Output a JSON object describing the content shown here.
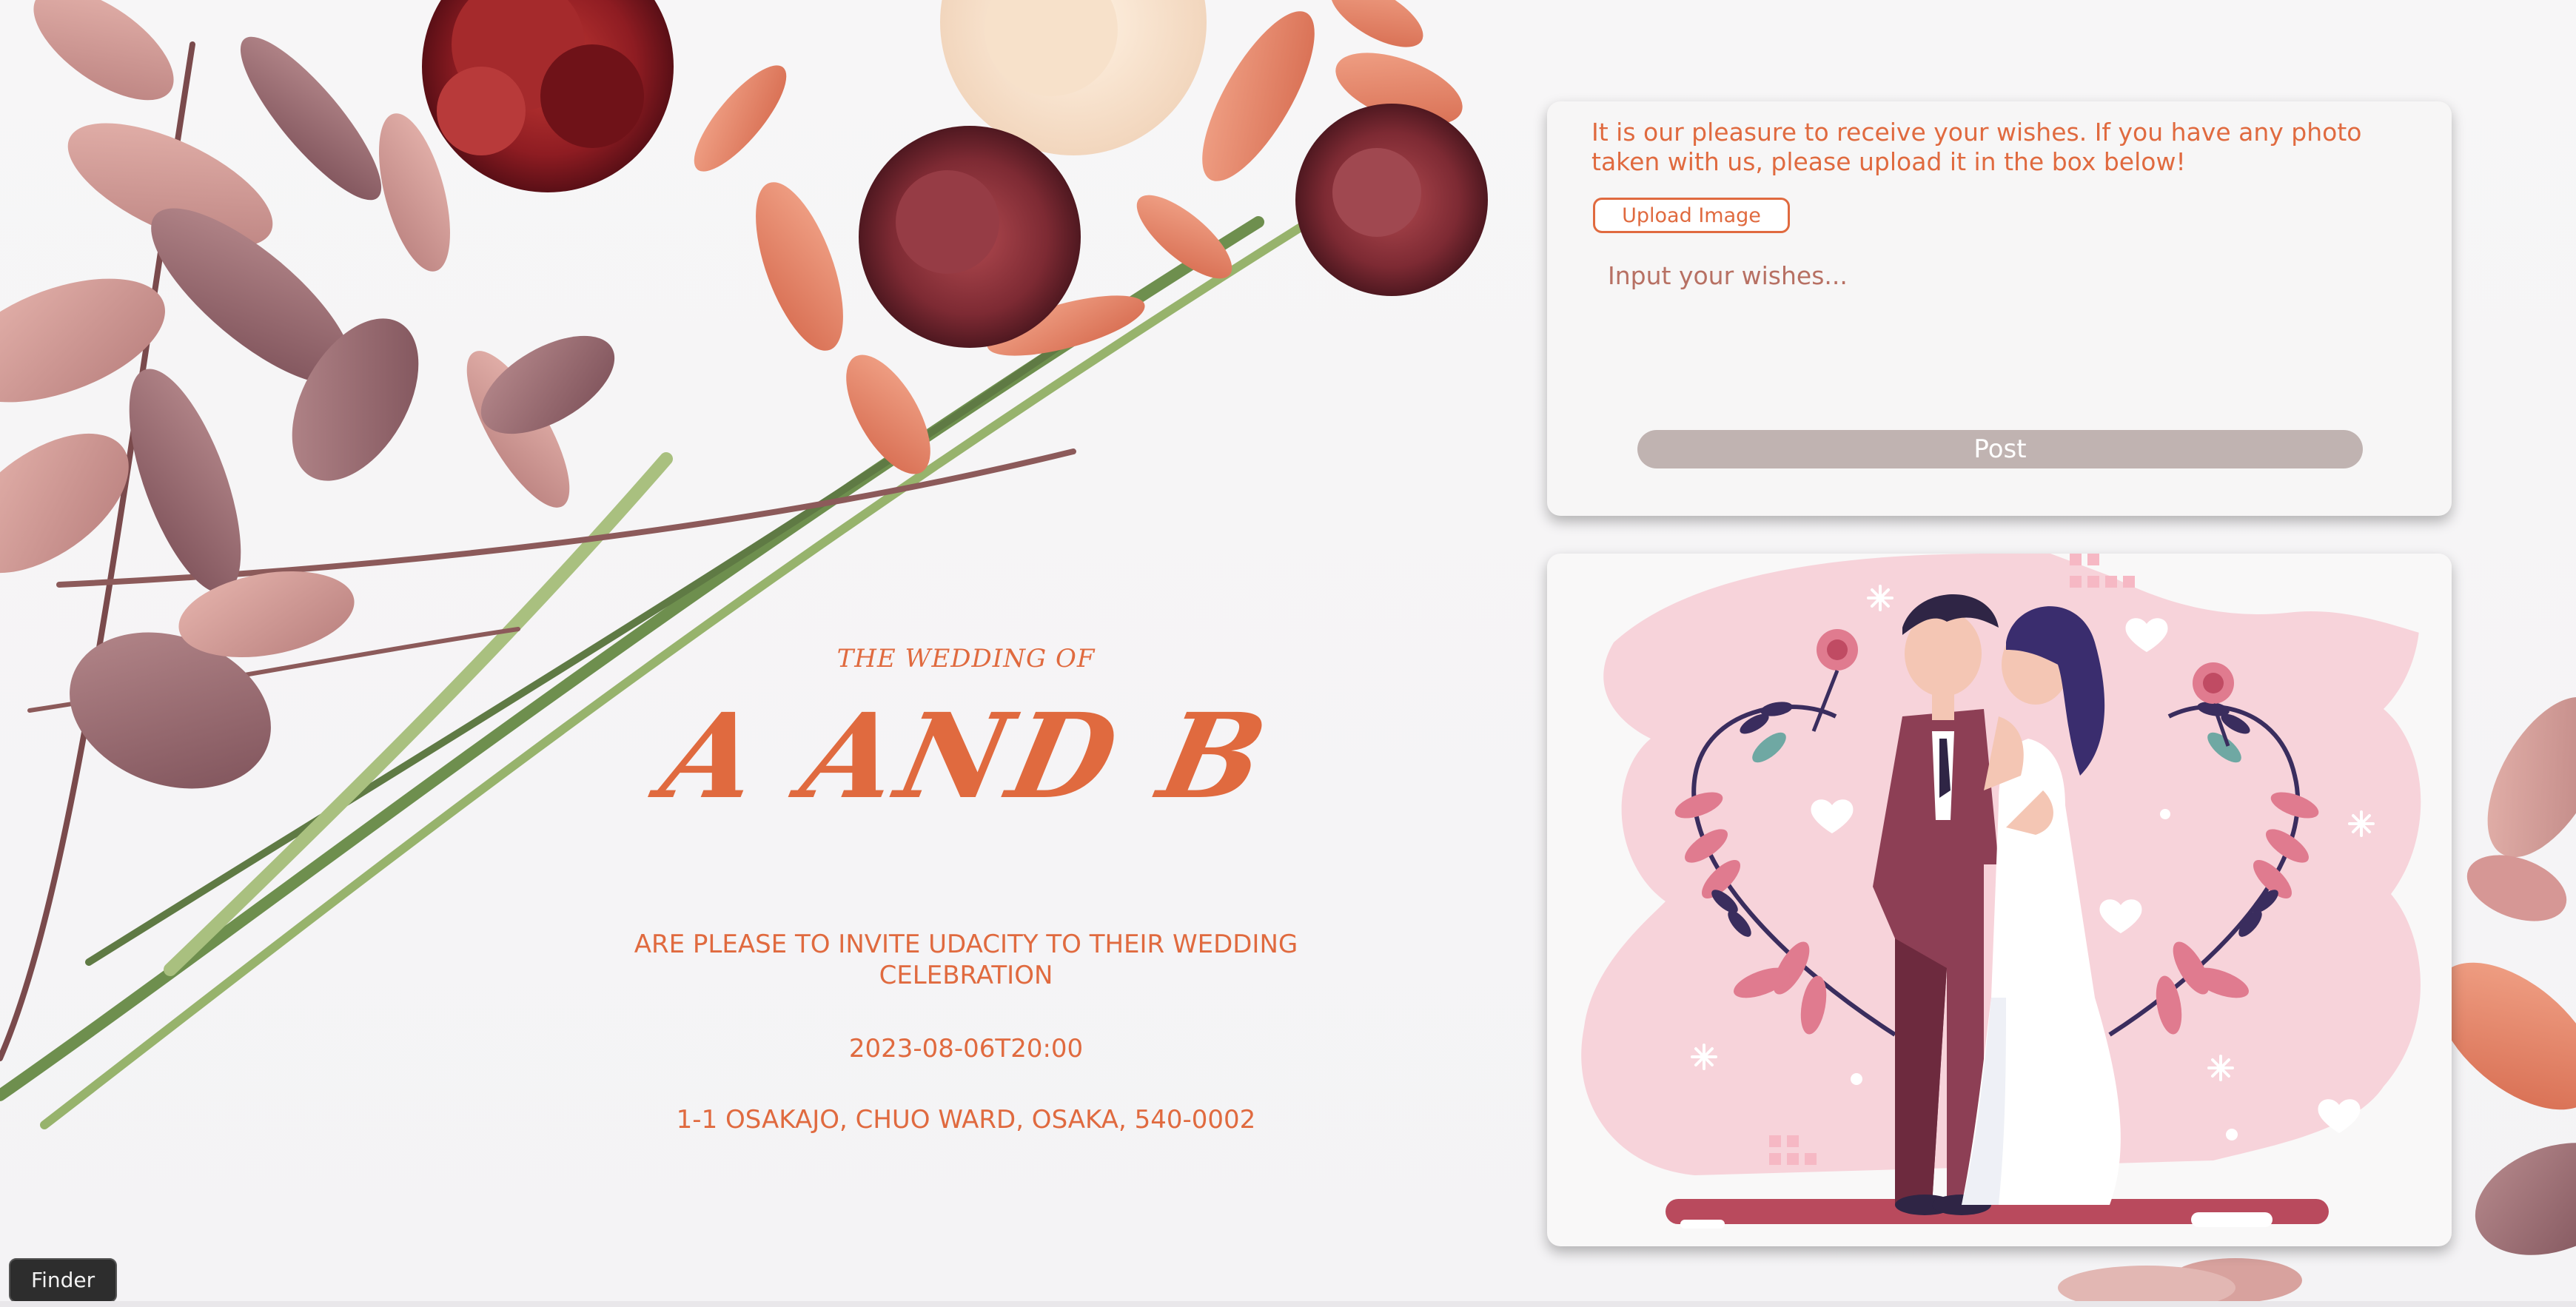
{
  "invitation": {
    "subtitle": "THE WEDDING OF",
    "couple": "A AND B",
    "message": "ARE PLEASE TO INVITE UDACITY TO THEIR WEDDING CELEBRATION",
    "datetime": "2023-08-06T20:00",
    "address": "1-1 OSAKAJO, CHUO WARD, OSAKA, 540-0002"
  },
  "wishes": {
    "intro": "It is our pleasure to receive your wishes. If you have any photo taken with us, please upload it in the box below!",
    "upload_label": "Upload Image",
    "input_placeholder": "Input your wishes...",
    "input_value": "",
    "post_label": "Post"
  },
  "illustration": {
    "icon": "wedding-couple-illustration"
  },
  "dock": {
    "tooltip": "Finder"
  },
  "colors": {
    "accent": "#e06a3f",
    "post_button": "#c0b3b1",
    "card_bg": "#f7f6f6",
    "illustration_pink": "#f7d3da"
  }
}
